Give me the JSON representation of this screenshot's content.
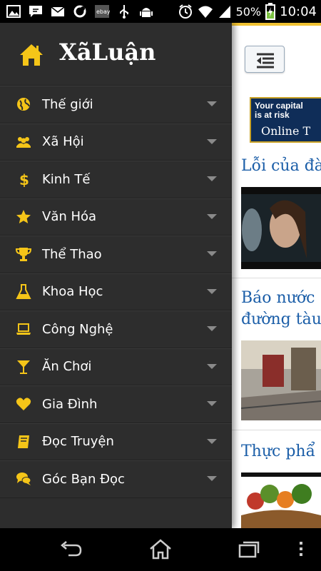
{
  "status_bar": {
    "battery_percent": "50%",
    "time": "10:04",
    "left_icons": [
      "gallery-icon",
      "message-icon",
      "mail-icon",
      "sync-icon",
      "ebay-icon",
      "usb-icon",
      "android-icon"
    ],
    "right_icons": [
      "alarm-icon",
      "wifi-icon",
      "signal-icon",
      "battery-icon"
    ]
  },
  "drawer": {
    "brand": "XãLuận",
    "accent_color": "#f5c518",
    "items": [
      {
        "label": "Thế giới",
        "icon": "globe-icon"
      },
      {
        "label": "Xã Hội",
        "icon": "people-icon"
      },
      {
        "label": "Kinh Tế",
        "icon": "dollar-icon"
      },
      {
        "label": "Văn Hóa",
        "icon": "star-icon"
      },
      {
        "label": "Thể Thao",
        "icon": "trophy-icon"
      },
      {
        "label": "Khoa Học",
        "icon": "flask-icon"
      },
      {
        "label": "Công Nghệ",
        "icon": "laptop-icon"
      },
      {
        "label": "Ăn Chơi",
        "icon": "cocktail-icon"
      },
      {
        "label": "Gia Đình",
        "icon": "heart-icon"
      },
      {
        "label": "Đọc Truyện",
        "icon": "book-icon"
      },
      {
        "label": "Góc Bạn Đọc",
        "icon": "comments-icon"
      }
    ]
  },
  "content": {
    "ad": {
      "line1": "Your capital",
      "line2": "is at risk",
      "line3": "Online T"
    },
    "articles": [
      {
        "title": "Lỗi của đà"
      },
      {
        "title_line1": "Báo nước",
        "title_line2": "đường tàu"
      },
      {
        "title": "Thực phẩ"
      }
    ],
    "title_color": "#1b5ea8"
  },
  "nav_bar": {
    "buttons": [
      "back-icon",
      "home-icon",
      "recent-apps-icon",
      "overflow-menu-icon"
    ]
  }
}
